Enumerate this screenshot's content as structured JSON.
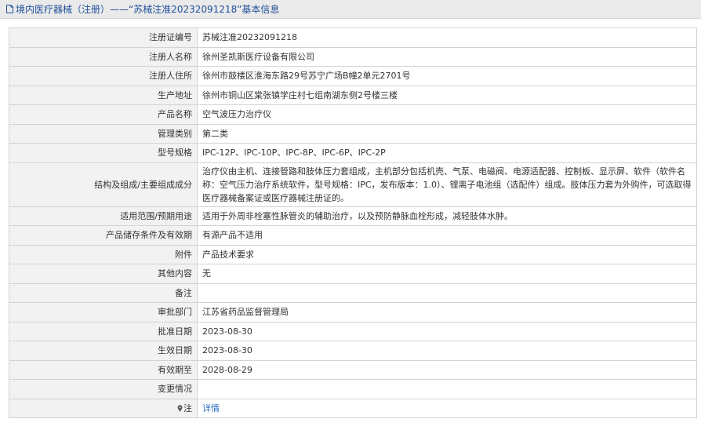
{
  "header": {
    "title": "境内医疗器械（注册）——“苏械注准20232091218”基本信息"
  },
  "rows": [
    {
      "label": "注册证编号",
      "value": "苏械注准20232091218"
    },
    {
      "label": "注册人名称",
      "value": "徐州圣凯斯医疗设备有限公司"
    },
    {
      "label": "注册人住所",
      "value": "徐州市鼓楼区淮海东路29号苏宁广场B幢2单元2701号"
    },
    {
      "label": "生产地址",
      "value": "徐州市铜山区棠张镇学庄村七组南湖东侧2号楼三楼"
    },
    {
      "label": "产品名称",
      "value": "空气波压力治疗仪"
    },
    {
      "label": "管理类别",
      "value": "第二类"
    },
    {
      "label": "型号规格",
      "value": "IPC-12P、IPC-10P、IPC-8P、IPC-6P、IPC-2P"
    },
    {
      "label": "结构及组成/主要组成成分",
      "value": "治疗仪由主机、连接管路和肢体压力套组成，主机部分包括机壳、气泵、电磁阀、电源适配器、控制板、显示屏、软件（软件名称：空气压力治疗系统软件，型号规格：IPC，发布版本：1.0）、锂离子电池组（选配件）组成。肢体压力套为外购件，可选取得医疗器械备案证或医疗器械注册证的。"
    },
    {
      "label": "适用范围/预期用途",
      "value": "适用于外周非栓塞性脉管炎的辅助治疗，以及预防静脉血栓形成，减轻肢体水肿。"
    },
    {
      "label": "产品储存条件及有效期",
      "value": "有源产品不适用"
    },
    {
      "label": "附件",
      "value": "产品技术要求"
    },
    {
      "label": "其他内容",
      "value": "无"
    },
    {
      "label": "备注",
      "value": ""
    },
    {
      "label": "审批部门",
      "value": "江苏省药品监督管理局"
    },
    {
      "label": "批准日期",
      "value": "2023-08-30"
    },
    {
      "label": "生效日期",
      "value": "2023-08-30"
    },
    {
      "label": "有效期至",
      "value": "2028-08-29"
    },
    {
      "label": "变更情况",
      "value": ""
    }
  ],
  "note": {
    "label": "注",
    "link": "详情"
  },
  "colors": {
    "header_bg": "#eaeaea",
    "title_color": "#1f4e9b",
    "label_bg": "#f2f2f2",
    "border": "#d3d3d3",
    "link": "#2a6dc4"
  }
}
